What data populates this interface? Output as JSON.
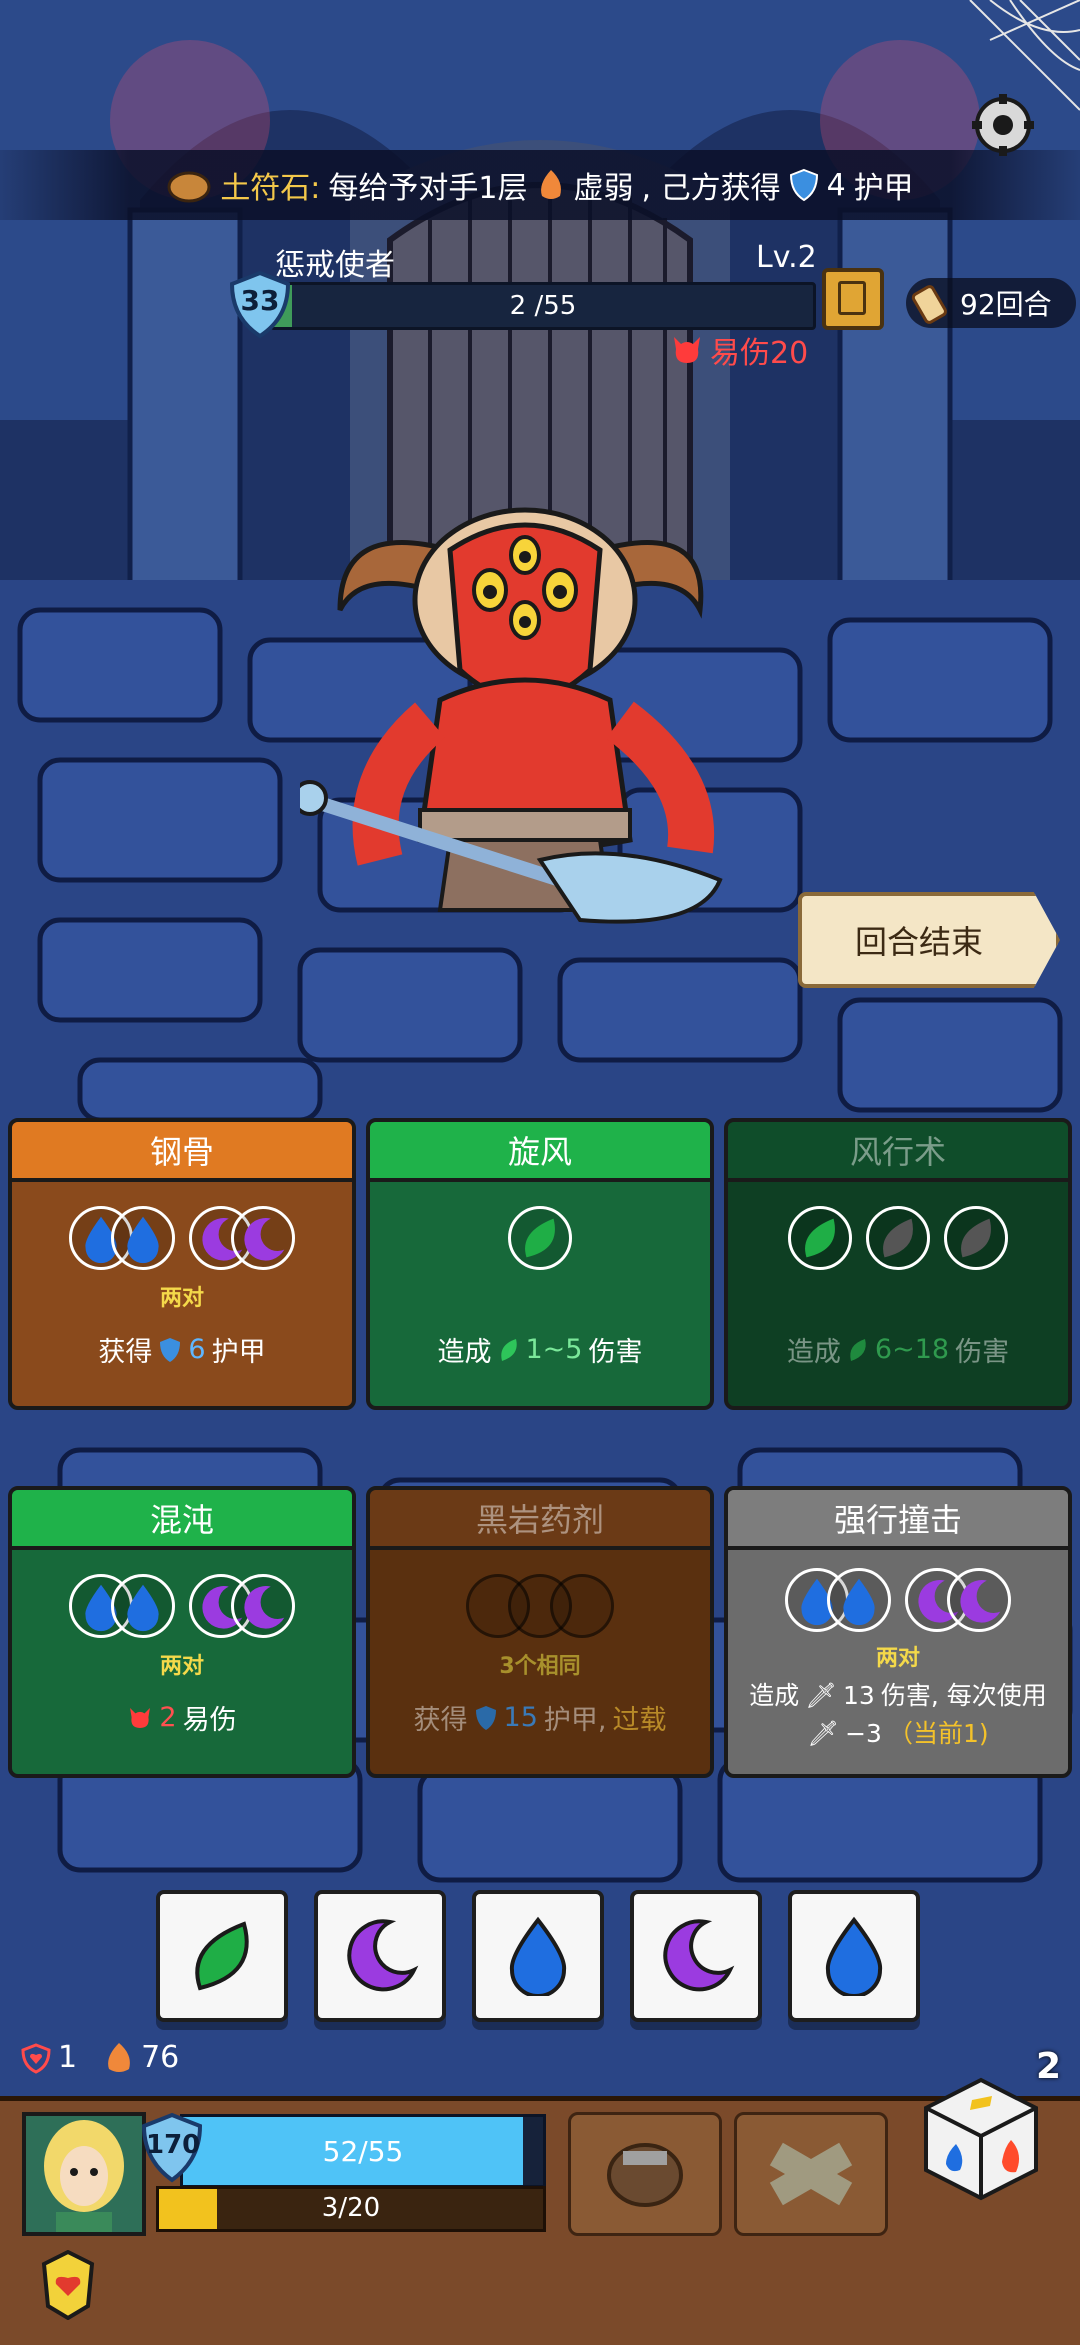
{
  "banner": {
    "stone_name": "土符石:",
    "text_before": "每给予对手1层",
    "debuff": "虚弱",
    "text_middle": ", 己方获得",
    "armor_value": "4",
    "armor_label": "护甲"
  },
  "enemy": {
    "name": "惩戒使者",
    "level": "Lv.2",
    "shield": "33",
    "hp_text": "2 /55",
    "hp_fraction": 0.036,
    "status": "易伤20"
  },
  "turns": {
    "label": "92回合"
  },
  "end_turn": {
    "label": "回合结束"
  },
  "cards": [
    {
      "title": "钢骨",
      "condition": "两对",
      "eff_prefix": "获得",
      "eff_value": "6",
      "eff_suffix": "护甲"
    },
    {
      "title": "旋风",
      "eff_prefix": "造成",
      "eff_value": "1~5",
      "eff_suffix": "伤害"
    },
    {
      "title": "风行术",
      "eff_prefix": "造成",
      "eff_value": "6~18",
      "eff_suffix": "伤害"
    },
    {
      "title": "混沌",
      "condition": "两对",
      "eff_value": "2",
      "eff_suffix": "易伤"
    },
    {
      "title": "黑岩药剂",
      "condition": "3个相同",
      "eff_prefix": "获得",
      "eff_value": "15",
      "eff_suffix": "护甲,",
      "eff_extra": "过载"
    },
    {
      "title": "强行撞击",
      "condition": "两对",
      "eff_prefix": "造成",
      "eff_value": "13",
      "eff_suffix": "伤害, 每次使用",
      "eff_line2": "−3",
      "eff_extra": "（当前1)"
    }
  ],
  "dice_tray": [
    "leaf",
    "moon",
    "drop",
    "moon",
    "drop"
  ],
  "player": {
    "status_heart": "1",
    "status_fire": "76",
    "shield": "170",
    "hp_text": "52/55",
    "hp_fraction": 0.945,
    "energy_text": "3/20",
    "energy_fraction": 0.15,
    "dice_count": "2"
  },
  "colors": {
    "orange_header": "#e07a22",
    "orange_body": "#8a4a1c",
    "green_header": "#1fb24a",
    "green_body": "#17693a",
    "dark_green_header": "#0f4d2a",
    "dark_green_body": "#0e3f23",
    "brown_header": "#6b3a16",
    "brown_body": "#5a300f",
    "grey_header": "#7d7d7d",
    "grey_body": "#6c6c6c"
  }
}
